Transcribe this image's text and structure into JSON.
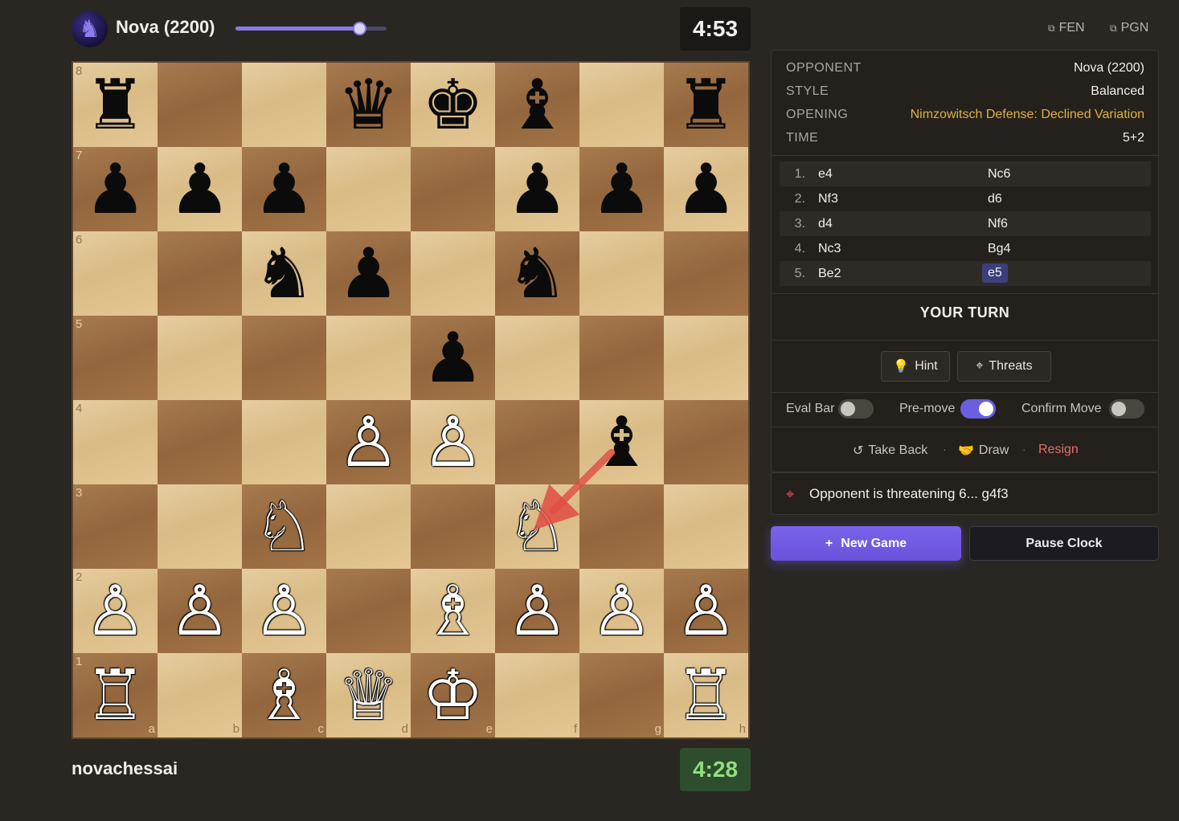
{
  "opponent": {
    "name": "Nova (2200)",
    "avatar_icon": "knight-avatar-icon",
    "clock": "4:53",
    "strength_slider_value": 0.82
  },
  "player": {
    "name": "novachessai",
    "clock": "4:28"
  },
  "board": {
    "ranks": [
      "8",
      "7",
      "6",
      "5",
      "4",
      "3",
      "2",
      "1"
    ],
    "files": [
      "a",
      "b",
      "c",
      "d",
      "e",
      "f",
      "g",
      "h"
    ],
    "squares": [
      [
        "♜",
        "",
        "",
        "♛",
        "♚",
        "♝",
        "",
        "♜"
      ],
      [
        "♟",
        "♟",
        "♟",
        "",
        "",
        "♟",
        "♟",
        "♟"
      ],
      [
        "",
        "",
        "♞",
        "♟",
        "",
        "♞",
        "",
        ""
      ],
      [
        "",
        "",
        "",
        "",
        "♟",
        "",
        "",
        ""
      ],
      [
        "",
        "",
        "",
        "♙",
        "♙",
        "",
        "♝",
        ""
      ],
      [
        "",
        "",
        "♘",
        "",
        "",
        "♘",
        "",
        ""
      ],
      [
        "♙",
        "♙",
        "♙",
        "",
        "♗",
        "♙",
        "♙",
        "♙"
      ],
      [
        "♖",
        "",
        "♗",
        "♕",
        "♔",
        "",
        "",
        "♖"
      ]
    ],
    "threat_arrow": {
      "from": "g4",
      "to": "f3",
      "color": "#e04c43"
    }
  },
  "export": {
    "fen_label": "FEN",
    "pgn_label": "PGN"
  },
  "info": {
    "opponent_label": "OPPONENT",
    "opponent_value": "Nova (2200)",
    "style_label": "STYLE",
    "style_value": "Balanced",
    "opening_label": "OPENING",
    "opening_value": "Nimzowitsch Defense: Declined Variation",
    "time_label": "TIME",
    "time_value": "5+2"
  },
  "moves": [
    {
      "num": "1.",
      "white": "e4",
      "black": "Nc6"
    },
    {
      "num": "2.",
      "white": "Nf3",
      "black": "d6"
    },
    {
      "num": "3.",
      "white": "d4",
      "black": "Nf6"
    },
    {
      "num": "4.",
      "white": "Nc3",
      "black": "Bg4"
    },
    {
      "num": "5.",
      "white": "Be2",
      "black": "e5"
    }
  ],
  "status": "YOUR TURN",
  "tools": {
    "hint_label": "Hint",
    "threats_label": "Threats"
  },
  "toggles": {
    "eval_bar_label": "Eval Bar",
    "eval_bar_on": false,
    "premove_label": "Pre-move",
    "premove_on": true,
    "confirm_label": "Confirm Move",
    "confirm_on": false
  },
  "actions": {
    "take_back": "Take Back",
    "draw": "Draw",
    "resign": "Resign",
    "separator": "·"
  },
  "threat_notice": "Opponent is threatening 6... g4f3",
  "buttons": {
    "new_game_icon": "+",
    "new_game": "New Game",
    "pause_clock": "Pause Clock"
  }
}
